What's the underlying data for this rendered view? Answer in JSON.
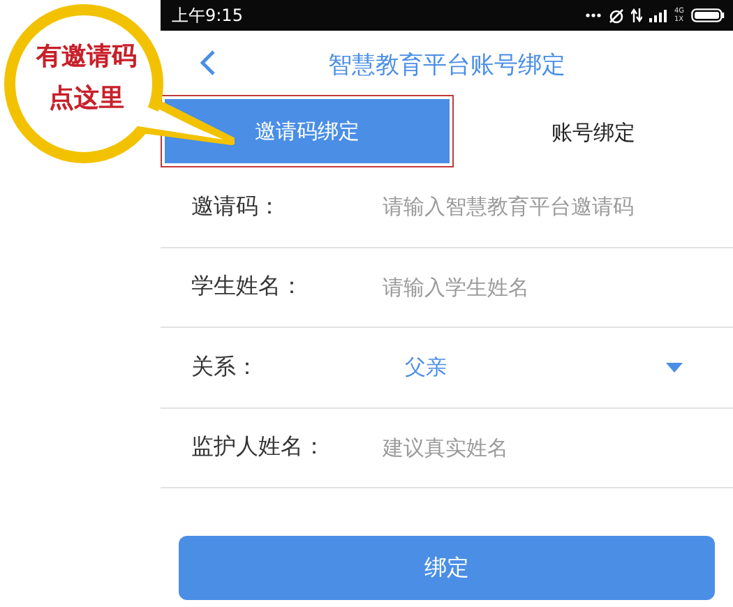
{
  "annotation": {
    "lines": [
      "有邀请码",
      "点这里"
    ]
  },
  "status_bar": {
    "time": "上午9:15",
    "network": [
      "4G",
      "1X"
    ]
  },
  "header": {
    "title": "智慧教育平台账号绑定"
  },
  "tabs": [
    {
      "label": "邀请码绑定",
      "selected": true,
      "highlighted": true
    },
    {
      "label": "账号绑定",
      "selected": false,
      "highlighted": false
    }
  ],
  "fields": [
    {
      "kind": "input",
      "label": "邀请码：",
      "placeholder": "请输入智慧教育平台邀请码"
    },
    {
      "kind": "input",
      "label": "学生姓名：",
      "placeholder": "请输入学生姓名"
    },
    {
      "kind": "select",
      "label": "关系：",
      "value": "父亲"
    },
    {
      "kind": "input",
      "label": "监护人姓名：",
      "placeholder": "建议真实姓名"
    }
  ],
  "submit_button": {
    "label": "绑定"
  }
}
